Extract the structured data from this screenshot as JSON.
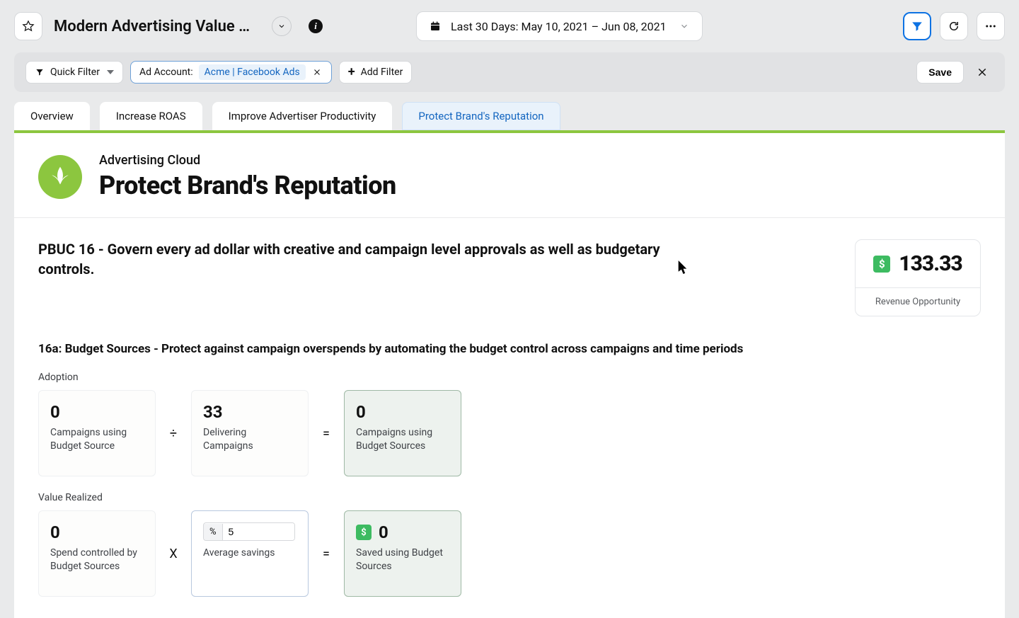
{
  "header": {
    "title": "Modern Advertising Value Realizati…",
    "date_label": "Last 30 Days: May 10, 2021 – Jun 08, 2021"
  },
  "filterbar": {
    "quick_filter": "Quick Filter",
    "ad_account_label": "Ad Account:",
    "ad_account_value": "Acme | Facebook Ads",
    "add_filter": "Add Filter",
    "save": "Save"
  },
  "tabs": {
    "t0": "Overview",
    "t1": "Increase ROAS",
    "t2": "Improve Advertiser Productivity",
    "t3": "Protect Brand's Reputation"
  },
  "panel": {
    "subtitle": "Advertising Cloud",
    "title": "Protect Brand's Reputation"
  },
  "pbuc": {
    "headline": "PBUC 16 - Govern every ad dollar with creative and campaign level approvals as well as budgetary controls.",
    "rev_value": "133.33",
    "rev_label": "Revenue Opportunity"
  },
  "section16a": {
    "heading": "16a: Budget Sources - Protect against campaign overspends by automating the budget control across campaigns and time periods",
    "adoption_label": "Adoption",
    "adoption": {
      "a_val": "0",
      "a_lbl": "Campaigns using Budget Source",
      "b_val": "33",
      "b_lbl": "Delivering Campaigns",
      "c_val": "0",
      "c_lbl": "Campaigns using Budget Sources"
    },
    "value_label": "Value Realized",
    "value": {
      "a_val": "0",
      "a_lbl": "Spend controlled by Budget Sources",
      "pct_sym": "%",
      "pct_input": "5",
      "pct_lbl": "Average savings",
      "c_val": "0",
      "c_lbl": "Saved using Budget Sources"
    },
    "ops": {
      "div": "÷",
      "eq": "=",
      "mul": "X"
    },
    "dollar": "$"
  }
}
